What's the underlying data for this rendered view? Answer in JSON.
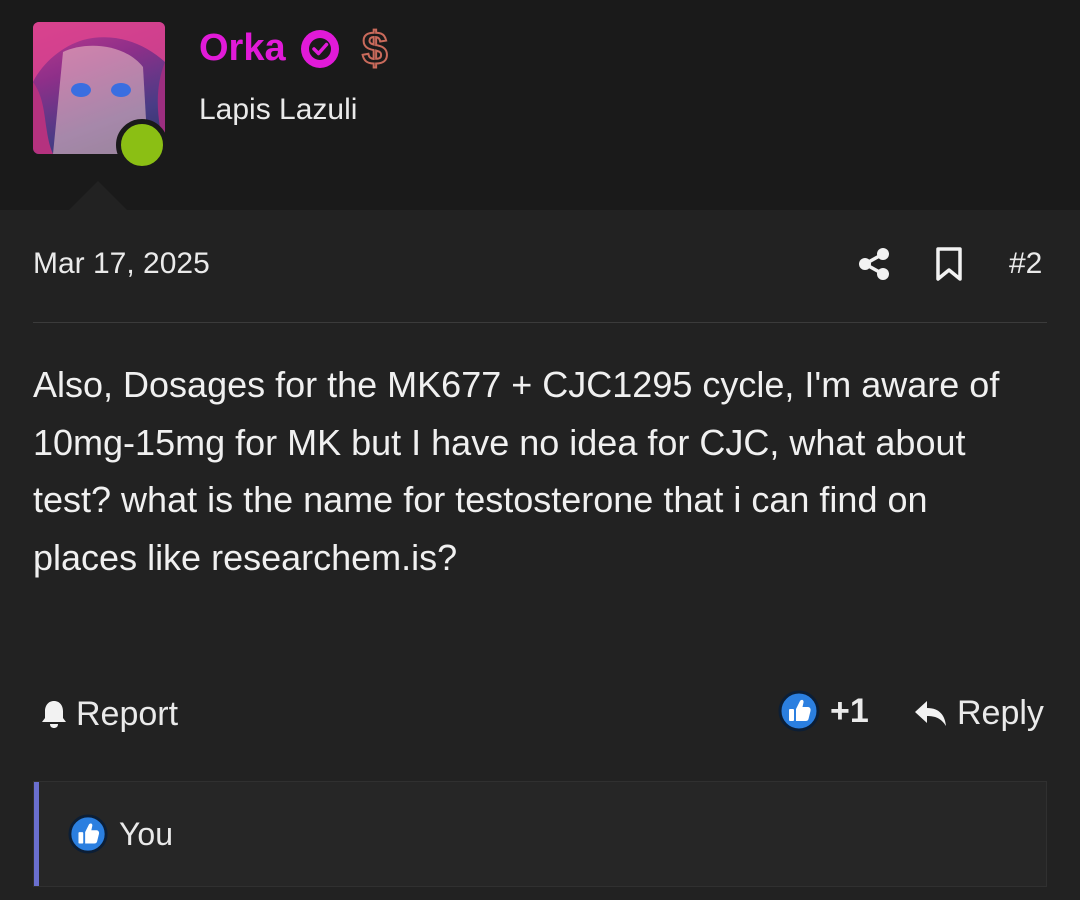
{
  "user": {
    "name": "Orka",
    "title": "Lapis Lazuli",
    "status": "online",
    "dollar_symbol": "$",
    "name_color": "#e11ad8"
  },
  "post": {
    "date": "Mar 17, 2025",
    "number": "#2",
    "message": "Also, Dosages for the MK677 + CJC1295 cycle, I'm aware of 10mg-15mg for MK but I have no idea for CJC, what about test? what is the name for testosterone that i can find on places like researchem.is?"
  },
  "actions": {
    "report_label": "Report",
    "reaction_count": "+1",
    "reply_label": "Reply"
  },
  "reactions": {
    "users": "You"
  },
  "icons": {
    "share": "share-icon",
    "bookmark": "bookmark-icon",
    "bell": "bell-icon",
    "like": "thumbs-up-icon",
    "reply": "reply-arrow-icon",
    "verified": "verified-badge-icon"
  }
}
